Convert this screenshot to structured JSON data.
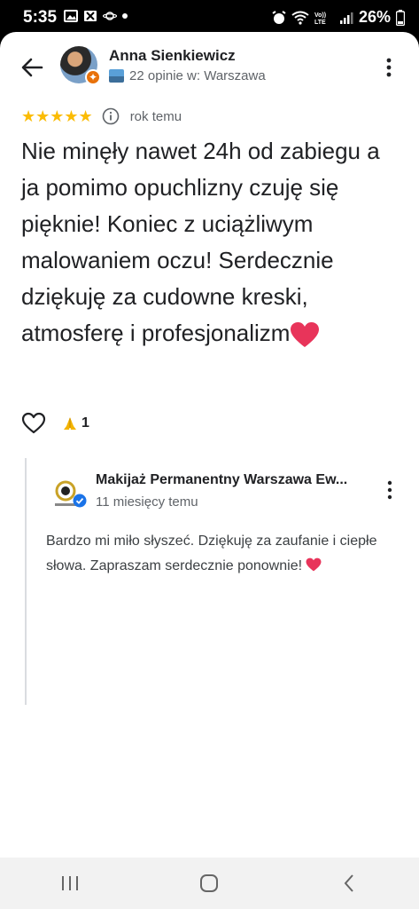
{
  "status_bar": {
    "time": "5:35",
    "battery": "26%"
  },
  "review": {
    "reviewer_name": "Anna Sienkiewicz",
    "reviewer_meta": "22 opinie w: Warszawa",
    "rating": 5,
    "stars_text": "★★★★★",
    "time_ago": "rok temu",
    "text": "Nie minęły nawet 24h od zabiegu a ja pomimo opuchlizny czuję się pięknie! Koniec z uciążliwym malowaniem oczu! Serdecznie dziękuję za cudowne kreski, atmosferę i profesjonalizm",
    "reaction_count": "1"
  },
  "reply": {
    "owner_name": "Makijaż Permanentny Warszawa Ew...",
    "time_ago": "11 miesięcy temu",
    "text": "Bardzo mi miło słyszeć. Dziękuję za zaufanie i ciepłe słowa. Zapraszam serdecznie ponownie!"
  },
  "icons": {
    "back": "arrow-left-icon",
    "menu": "more-vert-icon",
    "info": "info-icon",
    "like": "heart-outline-icon",
    "pray": "pray-emoji-icon",
    "heart_emoji": "red-heart-emoji",
    "nav_recents": "recents-icon",
    "nav_home": "home-icon",
    "nav_back": "nav-back-icon"
  },
  "colors": {
    "star": "#fbbc04",
    "text_primary": "#202124",
    "text_secondary": "#5f6368",
    "heart": "#e8345a",
    "verified": "#1a73e8"
  }
}
